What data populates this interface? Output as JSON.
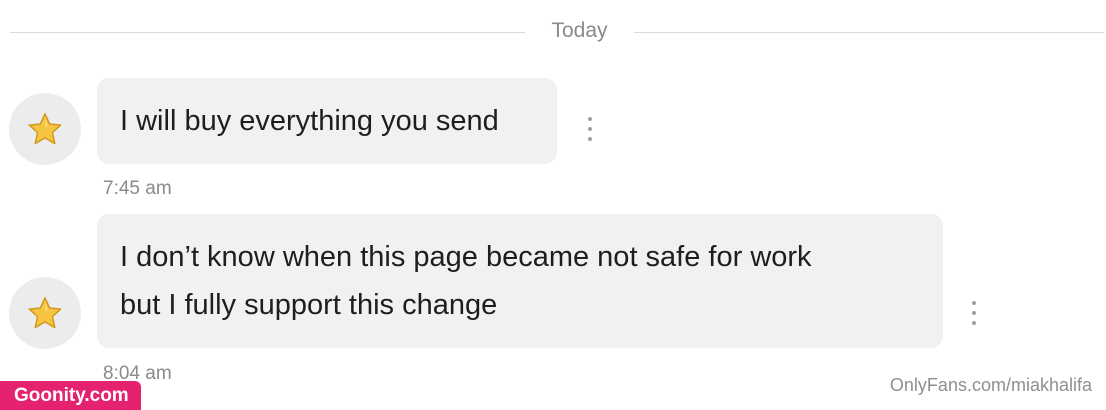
{
  "divider": {
    "label": "Today"
  },
  "messages": [
    {
      "avatar_icon": "star-icon",
      "lines": [
        "I will buy everything you send"
      ],
      "time": "7:45 am",
      "menu_icon": "more-vertical-icon"
    },
    {
      "avatar_icon": "star-icon",
      "lines": [
        "I don’t know when this page became not safe for work",
        "but I fully support this change"
      ],
      "time": "8:04 am",
      "menu_icon": "more-vertical-icon"
    }
  ],
  "watermarks": {
    "badge": "Goonity.com",
    "url": "OnlyFans.com/miakhalifa"
  },
  "colors": {
    "bubble": "#f1f1f1",
    "avatar": "#ececec",
    "star": "#f5c542",
    "badge": "#e5226f"
  }
}
